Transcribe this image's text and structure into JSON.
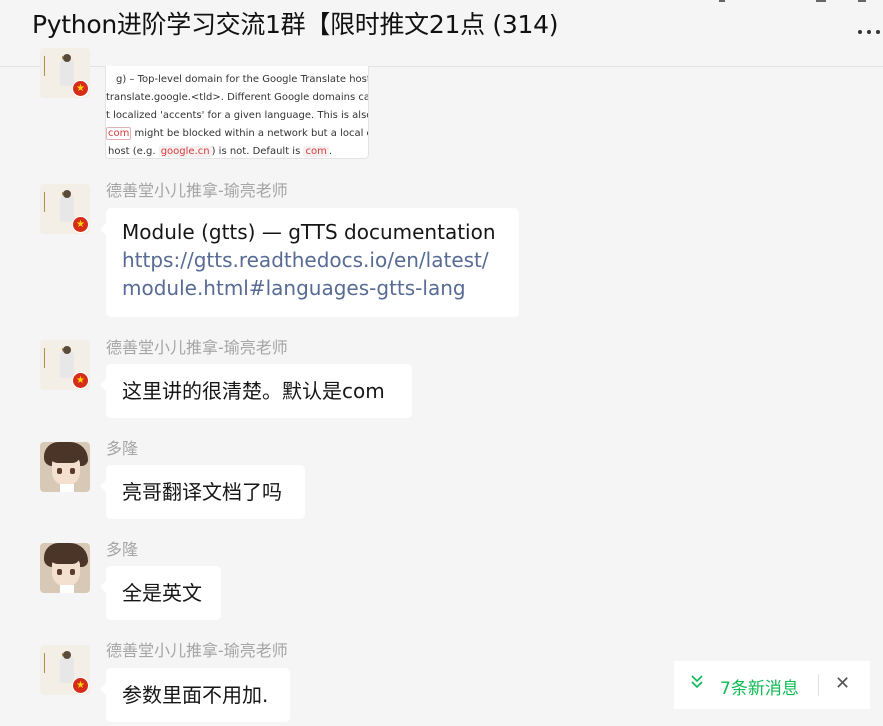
{
  "chat": {
    "title": "Python进阶学习交流1群【限时推文21点 (314)",
    "more_icon": "more-dots-icon"
  },
  "messages": [
    {
      "type": "image",
      "sender": "德善堂小儿推拿-瑜亮老师",
      "image_lines": [
        {
          "text": "g) – Top-level domain for the Google Translate host, i.e"
        },
        {
          "text": "translate.google.<tld>. Different Google domains can pro"
        },
        {
          "text": "t localized 'accents' for a given language. This is also us"
        },
        {
          "code": "com",
          "text": " might be blocked within a network but a local or d"
        },
        {
          "pre": "host (e.g. ",
          "code": "google.cn",
          "post": ") is not. Default is ",
          "code2": "com",
          "end": "."
        }
      ]
    },
    {
      "sender": "德善堂小儿推拿-瑜亮老师",
      "lines": [
        "Module (gtts) — gTTS documentation"
      ],
      "link_lines": [
        "https://gtts.readthedocs.io/en/latest/",
        "module.html#languages-gtts-lang"
      ]
    },
    {
      "sender": "德善堂小儿推拿-瑜亮老师",
      "text": "这里讲的很清楚。默认是com"
    },
    {
      "sender": "多隆",
      "text": "亮哥翻译文档了吗"
    },
    {
      "sender": "多隆",
      "text": "全是英文"
    },
    {
      "sender": "德善堂小儿推拿-瑜亮老师",
      "text": "参数里面不用加."
    }
  ],
  "new_messages_notice": {
    "text": "7条新消息",
    "icon": "double-chevron-down-icon",
    "close_icon": "close-icon",
    "accent_color": "#0dbb52"
  }
}
